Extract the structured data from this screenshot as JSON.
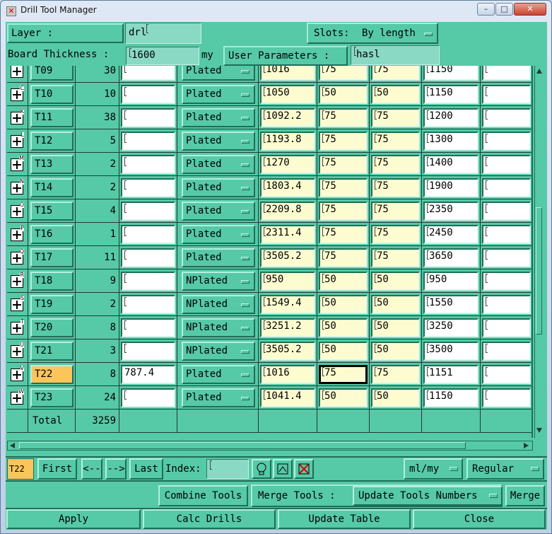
{
  "window": {
    "title": "Drill Tool Manager",
    "min": "–",
    "max": "□",
    "close": "✕",
    "icon": "app-x-icon"
  },
  "header": {
    "layer_label": "Layer            :",
    "layer_value": "drl",
    "slots_label": "Slots:",
    "slots_value": "By length",
    "thickness_label": "Board Thickness :",
    "thickness_value": "1600",
    "thickness_unit": "my",
    "user_params_label": "User Parameters :",
    "user_params_value": "hasl"
  },
  "rows": [
    {
      "letter": "",
      "tool": "T09",
      "count": "30",
      "f1": "",
      "type": "Plated",
      "finish": "1016",
      "p1": "75",
      "p2": "75",
      "drill": "1150",
      "last": ""
    },
    {
      "letter": "C",
      "tool": "T10",
      "count": "10",
      "f1": "",
      "type": "Plated",
      "finish": "1050",
      "p1": "50",
      "p2": "50",
      "drill": "1150",
      "last": ""
    },
    {
      "letter": "K",
      "tool": "T11",
      "count": "38",
      "f1": "",
      "type": "Plated",
      "finish": "1092.2",
      "p1": "75",
      "p2": "75",
      "drill": "1200",
      "last": ""
    },
    {
      "letter": "L",
      "tool": "T12",
      "count": "5",
      "f1": "",
      "type": "Plated",
      "finish": "1193.8",
      "p1": "75",
      "p2": "75",
      "drill": "1300",
      "last": ""
    },
    {
      "letter": "M",
      "tool": "T13",
      "count": "2",
      "f1": "",
      "type": "Plated",
      "finish": "1270",
      "p1": "75",
      "p2": "75",
      "drill": "1400",
      "last": ""
    },
    {
      "letter": "N",
      "tool": "T14",
      "count": "2",
      "f1": "",
      "type": "Plated",
      "finish": "1803.4",
      "p1": "75",
      "p2": "75",
      "drill": "1900",
      "last": ""
    },
    {
      "letter": "O",
      "tool": "T15",
      "count": "4",
      "f1": "",
      "type": "Plated",
      "finish": "2209.8",
      "p1": "75",
      "p2": "75",
      "drill": "2350",
      "last": ""
    },
    {
      "letter": "P",
      "tool": "T16",
      "count": "1",
      "f1": "",
      "type": "Plated",
      "finish": "2311.4",
      "p1": "75",
      "p2": "75",
      "drill": "2450",
      "last": ""
    },
    {
      "letter": "Q",
      "tool": "T17",
      "count": "11",
      "f1": "",
      "type": "Plated",
      "finish": "3505.2",
      "p1": "75",
      "p2": "75",
      "drill": "3650",
      "last": ""
    },
    {
      "letter": "R",
      "tool": "T18",
      "count": "9",
      "f1": "",
      "type": "NPlated",
      "finish": "950",
      "p1": "50",
      "p2": "50",
      "drill": "950",
      "last": ""
    },
    {
      "letter": "S",
      "tool": "T19",
      "count": "2",
      "f1": "",
      "type": "NPlated",
      "finish": "1549.4",
      "p1": "50",
      "p2": "50",
      "drill": "1550",
      "last": ""
    },
    {
      "letter": "T",
      "tool": "T20",
      "count": "8",
      "f1": "",
      "type": "NPlated",
      "finish": "3251.2",
      "p1": "50",
      "p2": "50",
      "drill": "3250",
      "last": ""
    },
    {
      "letter": "U",
      "tool": "T21",
      "count": "3",
      "f1": "",
      "type": "NPlated",
      "finish": "3505.2",
      "p1": "50",
      "p2": "50",
      "drill": "3500",
      "last": ""
    },
    {
      "letter": "V",
      "tool": "T22",
      "count": "8",
      "f1": "787.4",
      "type": "Plated",
      "finish": "1016",
      "p1": "75",
      "p2": "75",
      "drill": "1151",
      "last": "",
      "selected": true
    },
    {
      "letter": "W",
      "tool": "T23",
      "count": "24",
      "f1": "",
      "type": "Plated",
      "finish": "1041.4",
      "p1": "50",
      "p2": "50",
      "drill": "1150",
      "last": ""
    }
  ],
  "total": {
    "label": "Total",
    "value": "3259"
  },
  "nav": {
    "current": "T22",
    "first": "First",
    "prev": "<--",
    "next": "-->",
    "last": "Last",
    "index_label": "Index:",
    "index_value": "",
    "units": "ml/my",
    "mode": "Regular",
    "icon1": "bulb-icon",
    "icon2": "flow-icon",
    "icon3": "clear-icon"
  },
  "actions": {
    "combine": "Combine Tools",
    "merge_label": "Merge Tools :",
    "update_numbers": "Update Tools Numbers",
    "merge": "Merge",
    "apply": "Apply",
    "calc": "Calc Drills",
    "update_table": "Update Table",
    "close": "Close"
  },
  "colors": {
    "panel": "#56c9a6",
    "selected": "#fbc55c",
    "yellow_field": "#fdfcd0",
    "input_bg": "#8ad9c5"
  }
}
